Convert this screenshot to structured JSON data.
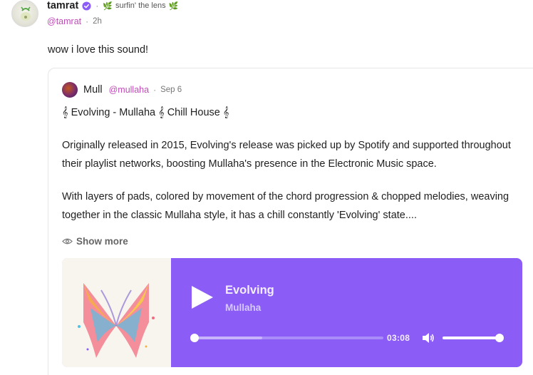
{
  "post": {
    "author": "tamrat",
    "channel_prefix_icon": "leaf-icon",
    "channel": "surfin' the lens",
    "handle": "@tamrat",
    "time": "2h",
    "separator": "·",
    "text": "wow i love this sound!"
  },
  "embed": {
    "author": "Mull",
    "handle": "@mullaha",
    "time": "Sep 6",
    "title": "𝄞 Evolving - Mullaha 𝄞 Chill House 𝄞",
    "paragraph1": "Originally released in 2015, Evolving's release was picked up by Spotify and supported throughout their playlist networks, boosting Mullaha's presence in the Electronic Music space.",
    "paragraph2": "With layers of pads, colored by movement of the chord progression & chopped melodies, weaving together in the classic Mullaha style, it has a chill constantly 'Evolving' state....",
    "show_more": "Show more"
  },
  "player": {
    "track_title": "Evolving",
    "artist": "Mullaha",
    "duration": "03:08",
    "progress": 0.36,
    "volume": 1.0,
    "accent_color": "#8b5cf6"
  },
  "colors": {
    "handle": "#c04bb8",
    "verified": "#8b5cf6"
  }
}
